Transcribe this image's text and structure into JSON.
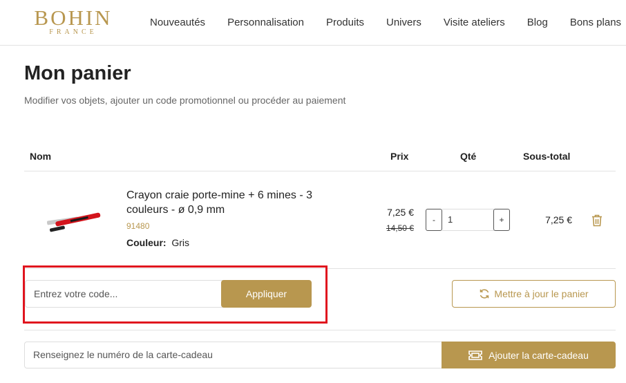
{
  "header": {
    "logo": {
      "main": "BOHIN",
      "sub": "FRANCE"
    },
    "nav": [
      "Nouveautés",
      "Personnalisation",
      "Produits",
      "Univers",
      "Visite ateliers",
      "Blog",
      "Bons plans"
    ]
  },
  "page": {
    "title": "Mon panier",
    "subtitle": "Modifier vos objets, ajouter un code promotionnel ou procéder au paiement"
  },
  "table": {
    "headers": {
      "name": "Nom",
      "price": "Prix",
      "qty": "Qté",
      "subtotal": "Sous-total"
    },
    "item": {
      "name": "Crayon craie porte-mine + 6 mines - 3 couleurs - ø 0,9 mm",
      "sku": "91480",
      "attr_label": "Couleur",
      "attr_value": "Gris",
      "price": "7,25 €",
      "price_old": "14,50 €",
      "qty_minus": "-",
      "qty": "1",
      "qty_plus": "+",
      "subtotal": "7,25 €"
    }
  },
  "coupon": {
    "placeholder": "Entrez votre code...",
    "apply": "Appliquer"
  },
  "update": {
    "label": "Mettre à jour le panier"
  },
  "giftcard": {
    "placeholder": "Renseignez le numéro de la carte-cadeau",
    "button": "Ajouter la carte-cadeau"
  },
  "colors": {
    "accent": "#b8974f",
    "highlight": "#e0141e"
  },
  "icons": {
    "update": "refresh-icon",
    "gift": "ticket-icon",
    "delete": "trash-icon"
  }
}
